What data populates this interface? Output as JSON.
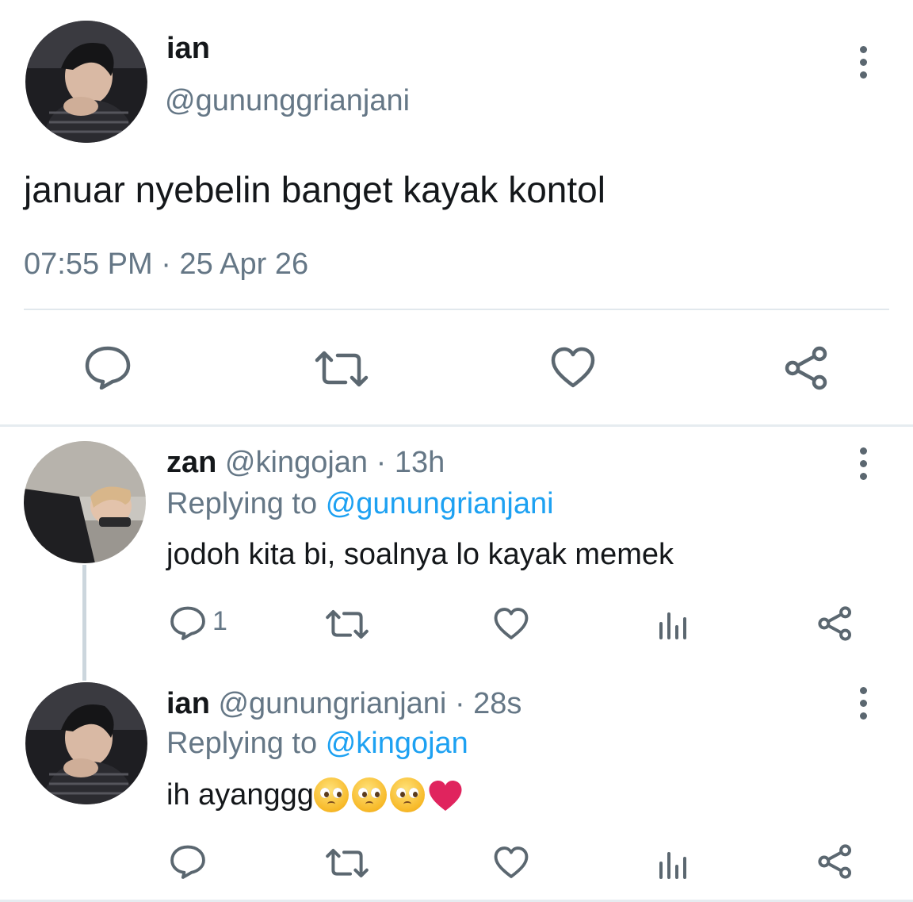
{
  "main_tweet": {
    "display_name": "ian",
    "handle": "@gununggrianjani",
    "text": "januar nyebelin banget kayak kontol",
    "time": "07:55 PM",
    "separator": "·",
    "date": "25 Apr 26"
  },
  "replies": [
    {
      "display_name": "zan",
      "handle": "@kingojan",
      "separator": "·",
      "time": "13h",
      "replying_prefix": "Replying to",
      "replying_to": "@gunungrianjani",
      "text": "jodoh kita bi, soalnya lo kayak memek",
      "reply_count": "1"
    },
    {
      "display_name": "ian",
      "handle": "@gunungrianjani",
      "separator": "·",
      "time": "28s",
      "replying_prefix": "Replying to",
      "replying_to": "@kingojan",
      "text": "ih ayanggg",
      "emoji": [
        "pleading-face",
        "pleading-face",
        "pleading-face",
        "red-heart"
      ]
    }
  ],
  "colors": {
    "link": "#1da1f2",
    "muted": "#657786",
    "icon": "#5b6770",
    "heart_emoji": "#e0245e"
  }
}
